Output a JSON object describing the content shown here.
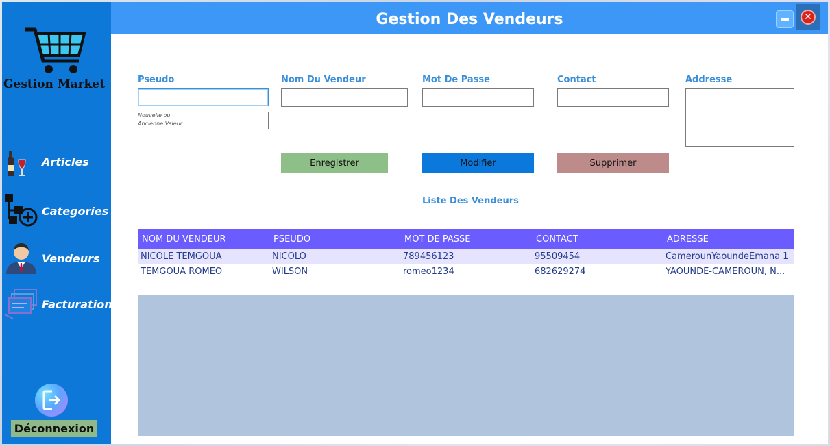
{
  "window": {
    "title": "Gestion Des Vendeurs",
    "minimize_icon": "minimize-icon",
    "close_icon": "close-icon"
  },
  "sidebar": {
    "brand": "Gestion Market",
    "items": [
      {
        "label": "Articles",
        "icon": "wine-bottle-icon"
      },
      {
        "label": "Categories",
        "icon": "category-add-icon"
      },
      {
        "label": "Vendeurs",
        "icon": "person-icon"
      },
      {
        "label": "Facturation",
        "icon": "invoice-icon"
      }
    ],
    "logout": {
      "label": "Déconnexion",
      "icon": "logout-icon"
    }
  },
  "form": {
    "pseudo_label": "Pseudo",
    "pseudo_value": "",
    "old_value_label": "Nouvelle ou Ancienne Valeur",
    "old_value": "",
    "nom_label": "Nom Du Vendeur",
    "nom_value": "",
    "password_label": "Mot De Passe",
    "password_value": "",
    "contact_label": "Contact",
    "contact_value": "",
    "address_label": "Addresse",
    "address_value": ""
  },
  "buttons": {
    "save": "Enregistrer",
    "modify": "Modifier",
    "delete": "Supprimer"
  },
  "list": {
    "title": "Liste Des Vendeurs",
    "columns": [
      "NOM DU VENDEUR",
      "PSEUDO",
      "MOT DE PASSE",
      "CONTACT",
      "ADRESSE"
    ],
    "rows": [
      [
        "NICOLE TEMGOUA",
        "NICOLO",
        "789456123",
        "95509454",
        "CamerounYaoundeEmana 1"
      ],
      [
        "TEMGOUA ROMEO",
        "WILSON",
        "romeo1234",
        "682629274",
        "YAOUNDE-CAMEROUN, N..."
      ]
    ]
  },
  "colors": {
    "sidebar": "#0e78d8",
    "header": "#3d97f7",
    "save_button": "#8fbf88",
    "modify_button": "#0b78dc",
    "delete_button": "#bd8c8a",
    "grid_header": "#6a5cff",
    "grid_empty": "#b0c4de"
  }
}
